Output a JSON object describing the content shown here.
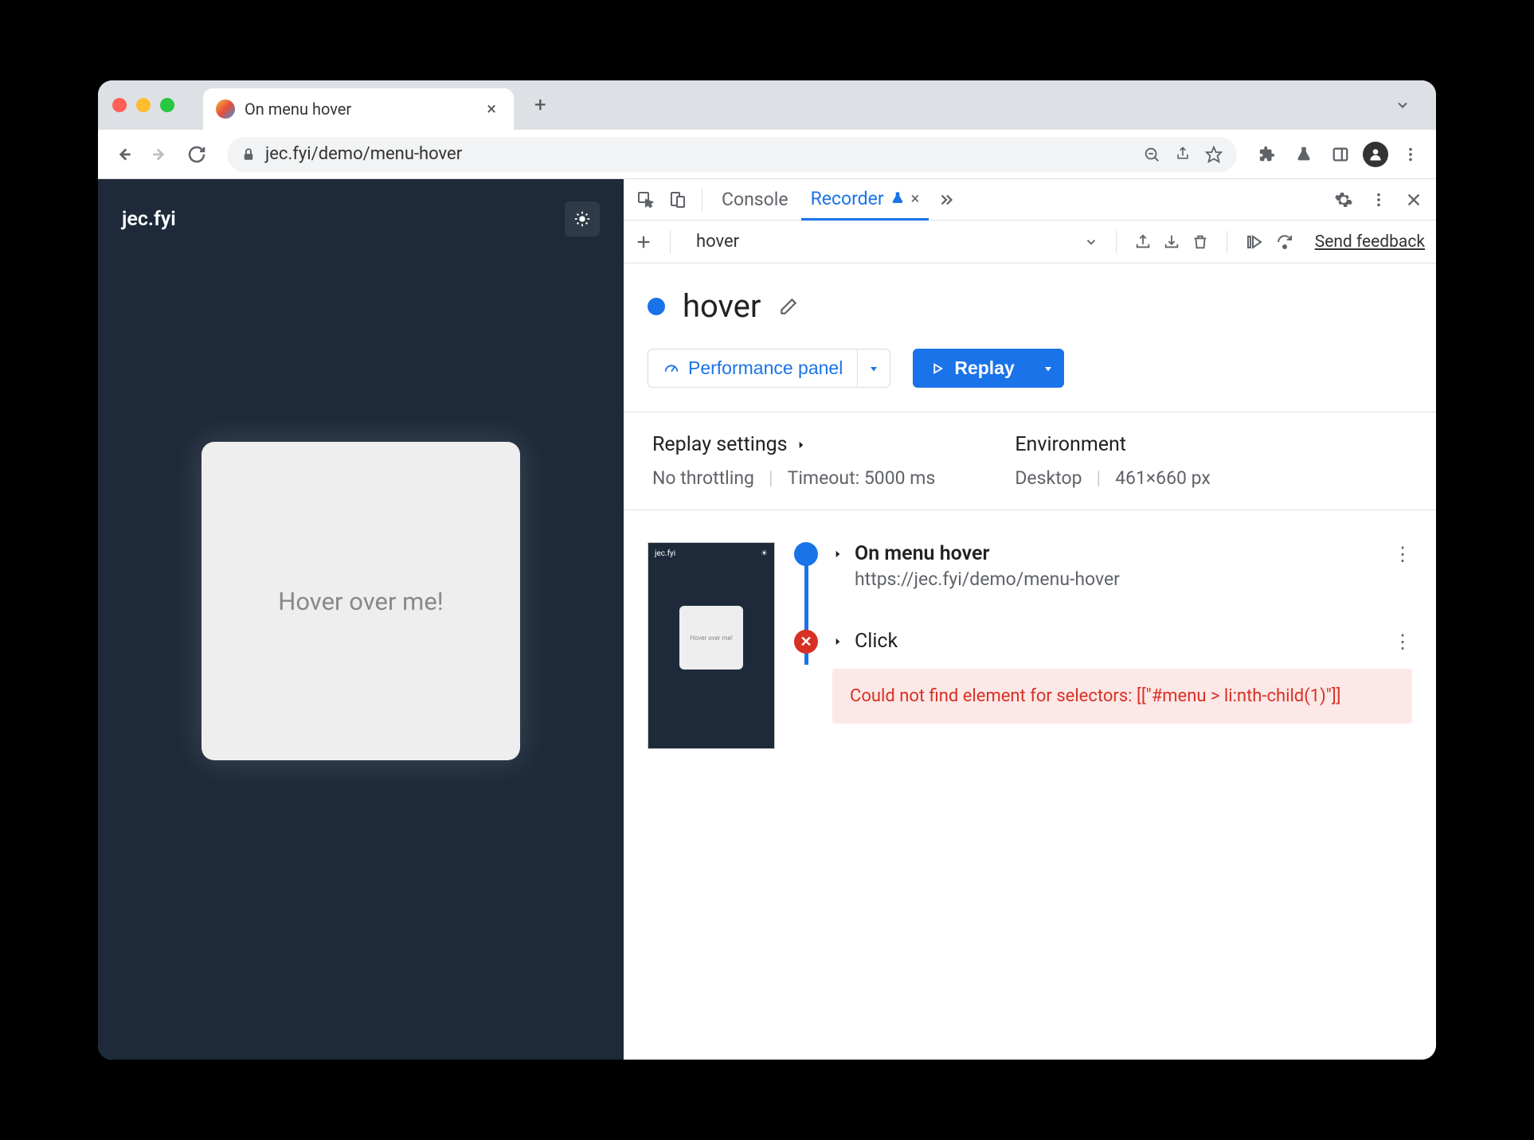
{
  "browser": {
    "tab_title": "On menu hover",
    "url": "jec.fyi/demo/menu-hover"
  },
  "page": {
    "logo": "jec.fyi",
    "hover_text": "Hover over me!"
  },
  "devtools": {
    "tabs": {
      "console": "Console",
      "recorder": "Recorder"
    },
    "recorder": {
      "recording_name": "hover",
      "title": "hover",
      "feedback": "Send feedback",
      "perf_panel_btn": "Performance panel",
      "replay_btn": "Replay",
      "replay_settings_label": "Replay settings",
      "throttling": "No throttling",
      "timeout": "Timeout: 5000 ms",
      "environment_label": "Environment",
      "env_device": "Desktop",
      "env_viewport": "461×660 px",
      "steps": [
        {
          "title": "On menu hover",
          "url": "https://jec.fyi/demo/menu-hover",
          "status": "ok"
        },
        {
          "title": "Click",
          "status": "error",
          "error": "Could not find element for selectors: [[\"#menu > li:nth-child(1)\"]]"
        }
      ],
      "thumbnail_text": "Hover over me!"
    }
  }
}
